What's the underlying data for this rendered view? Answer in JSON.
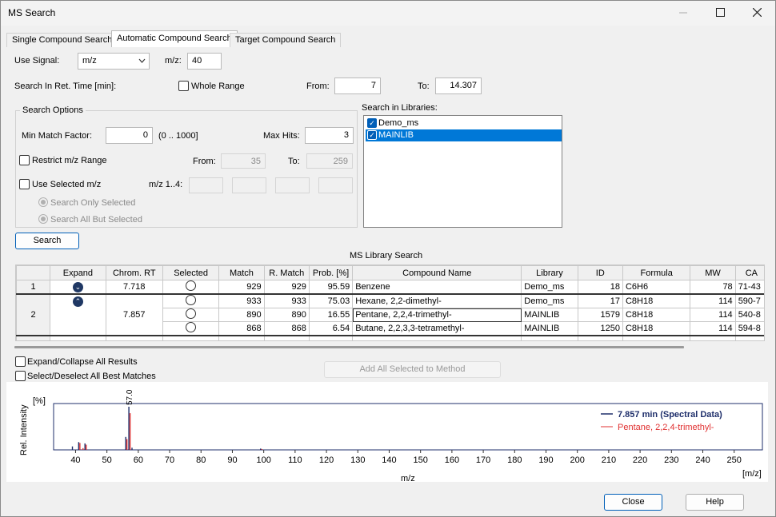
{
  "window": {
    "title": "MS Search",
    "minimize_icon": "minimize-icon",
    "maximize_icon": "maximize-icon",
    "close_icon": "close-icon"
  },
  "tabs": [
    {
      "label": "Single Compound Search"
    },
    {
      "label": "Automatic Compound Search"
    },
    {
      "label": "Target Compound Search"
    }
  ],
  "signal": {
    "label": "Use Signal:",
    "value": "m/z",
    "mz_label": "m/z:",
    "mz_value": "40"
  },
  "ret_time": {
    "label": "Search In Ret. Time [min]:",
    "whole_range_label": "Whole Range",
    "from_label": "From:",
    "from_value": "7",
    "to_label": "To:",
    "to_value": "14.307"
  },
  "search_options": {
    "title": "Search Options",
    "min_match_label": "Min Match Factor:",
    "min_match_value": "0",
    "range_hint": "(0 .. 1000]",
    "max_hits_label": "Max Hits:",
    "max_hits_value": "3",
    "restrict_label": "Restrict m/z Range",
    "restrict_from_label": "From:",
    "restrict_from_value": "35",
    "restrict_to_label": "To:",
    "restrict_to_value": "259",
    "use_selected_label": "Use Selected m/z",
    "mz14_label": "m/z 1..4:",
    "only_selected_label": "Search Only Selected",
    "all_but_label": "Search All But Selected"
  },
  "libraries": {
    "label": "Search in Libraries:",
    "items": [
      {
        "name": "Demo_ms",
        "checked": true
      },
      {
        "name": "MAINLIB",
        "checked": true,
        "selected": true
      }
    ]
  },
  "search_button": "Search",
  "table": {
    "title": "MS Library Search",
    "columns": [
      "Expand",
      "Chrom. RT",
      "Selected",
      "Match",
      "R. Match",
      "Prob. [%]",
      "Compound Name",
      "Library",
      "ID",
      "Formula",
      "MW",
      "CA"
    ],
    "rows": [
      {
        "index": "1",
        "rt": "7.718",
        "expand": "collapse",
        "hits": [
          {
            "match": "929",
            "rmatch": "929",
            "prob": "95.59",
            "name": "Benzene",
            "library": "Demo_ms",
            "id": "18",
            "formula": "C6H6",
            "mw": "78",
            "cas": "71-43"
          }
        ]
      },
      {
        "index": "2",
        "rt": "7.857",
        "expand": "expand",
        "hits": [
          {
            "match": "933",
            "rmatch": "933",
            "prob": "75.03",
            "name": "Hexane, 2,2-dimethyl-",
            "library": "Demo_ms",
            "id": "17",
            "formula": "C8H18",
            "mw": "114",
            "cas": "590-7"
          },
          {
            "match": "890",
            "rmatch": "890",
            "prob": "16.55",
            "name": "Pentane, 2,2,4-trimethyl-",
            "library": "MAINLIB",
            "id": "1579",
            "formula": "C8H18",
            "mw": "114",
            "cas": "540-8"
          },
          {
            "match": "868",
            "rmatch": "868",
            "prob": "6.54",
            "name": "Butane, 2,2,3,3-tetramethyl-",
            "library": "MAINLIB",
            "id": "1250",
            "formula": "C8H18",
            "mw": "114",
            "cas": "594-8"
          }
        ]
      }
    ]
  },
  "expand_collapse_label": "Expand/Collapse All Results",
  "select_best_label": "Select/Deselect All Best Matches",
  "add_button": "Add All Selected to Method",
  "chart_data": {
    "type": "bar",
    "xlabel": "m/z",
    "ylabel": "Rel. Intensity",
    "y_unit": "[%]",
    "x_unit": "[m/z]",
    "xlim": [
      33,
      259
    ],
    "x_ticks": [
      40,
      50,
      60,
      70,
      80,
      90,
      100,
      110,
      120,
      130,
      140,
      150,
      160,
      170,
      180,
      190,
      200,
      210,
      220,
      230,
      240,
      250
    ],
    "peak_annotation": "57.0",
    "series": [
      {
        "name": "7.857 min (Spectral Data)",
        "color": "#1f2f6b",
        "x": [
          39,
          41,
          43,
          56,
          57,
          58,
          99
        ],
        "values": [
          8,
          18,
          15,
          30,
          100,
          5,
          3
        ]
      },
      {
        "name": "Pentane, 2,2,4-trimethyl-",
        "color": "#e03030",
        "x": [
          41,
          42,
          43,
          56,
          57,
          99
        ],
        "values": [
          16,
          4,
          12,
          25,
          85,
          2
        ]
      }
    ]
  },
  "buttons": {
    "close": "Close",
    "help": "Help"
  }
}
